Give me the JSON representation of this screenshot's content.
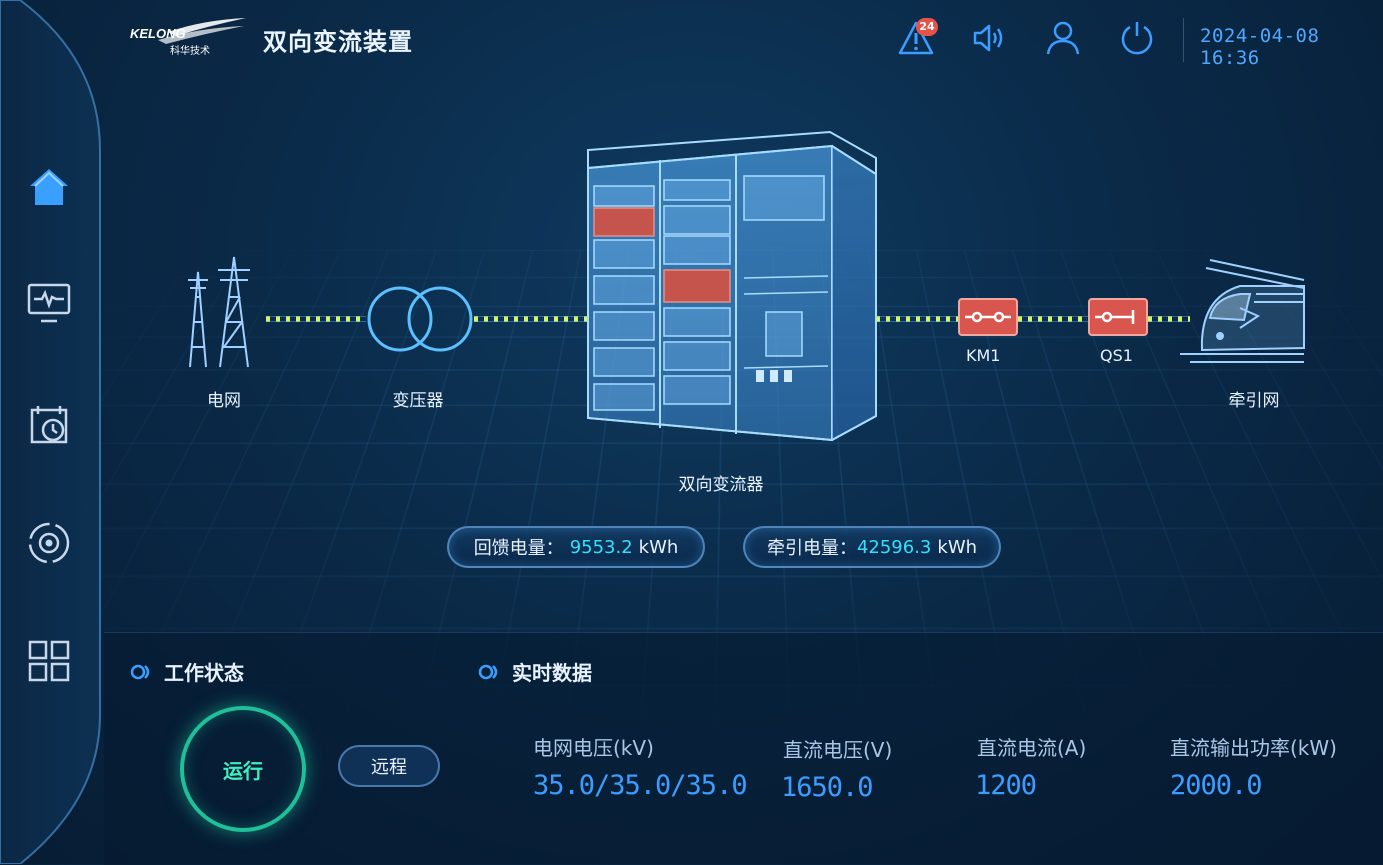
{
  "header": {
    "logo_text": "KELONG",
    "logo_sub": "科华技术",
    "title": "双向变流装置",
    "alarm_count": "24",
    "datetime": "2024-04-08 16:36"
  },
  "sidebar": {
    "items": [
      {
        "icon": "home-icon"
      },
      {
        "icon": "monitor-icon"
      },
      {
        "icon": "history-icon"
      },
      {
        "icon": "settings-icon"
      },
      {
        "icon": "apps-icon"
      }
    ]
  },
  "diagram": {
    "grid_label": "电网",
    "transformer_label": "变压器",
    "converter_label": "双向变流器",
    "km1_label": "KM1",
    "qs1_label": "QS1",
    "traction_label": "牵引网",
    "feedback": {
      "label": "回馈电量：",
      "value": "9553.2",
      "unit": "kWh"
    },
    "traction": {
      "label": "牵引电量：",
      "value": "42596.3",
      "unit": "kWh"
    }
  },
  "work_status": {
    "title": "工作状态",
    "state": "运行",
    "mode": "远程"
  },
  "realtime": {
    "title": "实时数据",
    "items": [
      {
        "label": "电网电压(kV)",
        "value": "35.0/35.0/35.0"
      },
      {
        "label": "直流电压(V)",
        "value": "1650.0"
      },
      {
        "label": "直流电流(A)",
        "value": "1200"
      },
      {
        "label": "直流输出功率(kW)",
        "value": "2000.0"
      }
    ]
  },
  "colors": {
    "accent": "#3d9cff",
    "running": "#3ef0bf",
    "switch": "#d9564f"
  }
}
